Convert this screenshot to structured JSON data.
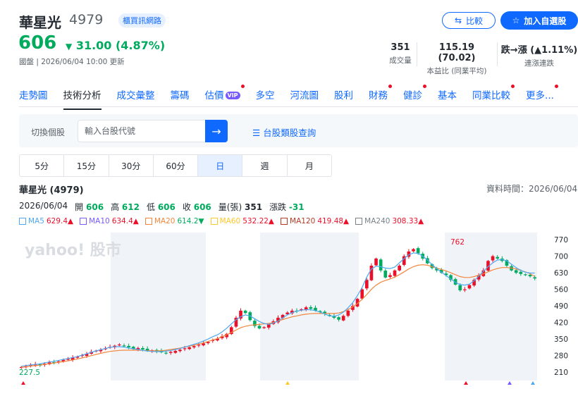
{
  "stock": {
    "name": "華星光",
    "code": "4979",
    "market_badge": "櫃買訊網路",
    "price": "606",
    "change": "31.00 (4.87%)",
    "updated": "國盤 | 2026/06/04 10:00 更新"
  },
  "actions": {
    "compare": "比較",
    "watchlist": "加入自選股"
  },
  "stats": [
    {
      "value": "351",
      "label": "成交量"
    },
    {
      "value": "115.19 (70.02)",
      "label": "本益比 (同業平均)"
    },
    {
      "value": "跌→漲 (▲1.11%)",
      "label": "連漲連跌"
    }
  ],
  "nav": [
    {
      "label": "走勢圖",
      "active": false,
      "dot": false
    },
    {
      "label": "技術分析",
      "active": true,
      "dot": false
    },
    {
      "label": "成交彙整",
      "active": false,
      "dot": false
    },
    {
      "label": "籌碼",
      "active": false,
      "dot": false
    },
    {
      "label": "估價",
      "active": false,
      "dot": true,
      "vip": "VIP"
    },
    {
      "label": "多空",
      "active": false,
      "dot": false
    },
    {
      "label": "河流圖",
      "active": false,
      "dot": false
    },
    {
      "label": "股利",
      "active": false,
      "dot": false
    },
    {
      "label": "財務",
      "active": false,
      "dot": true
    },
    {
      "label": "健診",
      "active": false,
      "dot": true
    },
    {
      "label": "基本",
      "active": false,
      "dot": false
    },
    {
      "label": "同業比較",
      "active": false,
      "dot": true
    },
    {
      "label": "更多...",
      "active": false,
      "dot": true
    }
  ],
  "search": {
    "label": "切換個股",
    "placeholder": "輸入台股代號",
    "category_link": "台股類股查詢"
  },
  "periods": [
    "5分",
    "15分",
    "30分",
    "60分",
    "日",
    "週",
    "月"
  ],
  "active_period": "日",
  "chart_header": {
    "title": "華星光 (4979)",
    "data_time": "資料時間：2026/06/04",
    "date": "2026/06/04",
    "open_label": "開",
    "open": "606",
    "high_label": "高",
    "high": "612",
    "low_label": "低",
    "low": "606",
    "close_label": "收",
    "close": "606",
    "volume_label": "量(張)",
    "volume": "351",
    "change_label": "漲跌",
    "change": "-31"
  },
  "moving_averages": [
    {
      "name": "MA5",
      "value": "629.4▲",
      "color": "#4fa8f0"
    },
    {
      "name": "MA10",
      "value": "634.4▲",
      "color": "#7759ff"
    },
    {
      "name": "MA20",
      "value": "614.2▼",
      "color": "#f2873d"
    },
    {
      "name": "MA60",
      "value": "532.22▲",
      "color": "#ffc72c"
    },
    {
      "name": "MA120",
      "value": "419.48▲",
      "color": "#b43c27"
    },
    {
      "name": "MA240",
      "value": "308.33▲",
      "color": "#7a8288"
    }
  ],
  "colors": {
    "up": "#eb0f29",
    "down": "#00ab5e",
    "accent": "#0f69ff"
  },
  "chart_data": {
    "type": "candlestick",
    "watermark": "yahoo! 股市",
    "y_ticks": [
      770,
      700,
      630,
      560,
      490,
      420,
      350,
      280,
      210
    ],
    "ylim": [
      175,
      800
    ],
    "max_label": "762",
    "min_label": "227.5",
    "closes": [
      232,
      236,
      240,
      244,
      238,
      246,
      252,
      249,
      256,
      262,
      266,
      272,
      276,
      282,
      288,
      296,
      301,
      306,
      311,
      317,
      322,
      327,
      322,
      315,
      308,
      312,
      306,
      300,
      303,
      298,
      294,
      290,
      296,
      300,
      305,
      311,
      315,
      320,
      326,
      332,
      338,
      346,
      352,
      362,
      372,
      400,
      440,
      470,
      460,
      430,
      405,
      395,
      400,
      412,
      425,
      440,
      452,
      462,
      470,
      468,
      476,
      484,
      478,
      470,
      464,
      456,
      448,
      440,
      432,
      448,
      470,
      490,
      520,
      560,
      600,
      660,
      690,
      640,
      610,
      620,
      640,
      660,
      700,
      720,
      730,
      712,
      690,
      670,
      650,
      640,
      630,
      620,
      600,
      580,
      556,
      560,
      578,
      600,
      620,
      640,
      680,
      700,
      690,
      680,
      660,
      640,
      630,
      625,
      620,
      615,
      606
    ],
    "ma5": [
      235,
      238,
      241,
      243,
      245,
      250,
      253,
      256,
      260,
      264,
      268,
      272,
      276,
      282,
      288,
      294,
      300,
      305,
      310,
      315,
      318,
      318,
      316,
      312,
      309,
      306,
      302,
      299,
      298,
      297,
      297,
      299,
      302,
      306,
      310,
      316,
      322,
      328,
      334,
      342,
      350,
      360,
      368,
      380,
      396,
      414,
      432,
      444,
      452,
      448,
      436,
      424,
      416,
      412,
      418,
      426,
      440,
      452,
      462,
      468,
      472,
      474,
      474,
      470,
      464,
      456,
      448,
      446,
      452,
      464,
      482,
      504,
      534,
      568,
      612,
      646,
      658,
      656,
      650,
      648,
      654,
      672,
      690,
      706,
      714,
      712,
      700,
      684,
      664,
      648,
      632,
      618,
      604,
      590,
      580,
      578,
      582,
      596,
      616,
      636,
      656,
      672,
      684,
      686,
      680,
      666,
      652,
      640,
      632,
      629,
      629
    ],
    "ma20": [
      230,
      233,
      236,
      238,
      240,
      243,
      246,
      249,
      252,
      255,
      258,
      262,
      266,
      270,
      275,
      280,
      285,
      290,
      294,
      298,
      300,
      302,
      303,
      303,
      303,
      303,
      302,
      301,
      301,
      300,
      301,
      303,
      306,
      309,
      312,
      316,
      320,
      324,
      328,
      334,
      340,
      346,
      352,
      360,
      368,
      378,
      388,
      398,
      404,
      408,
      410,
      412,
      414,
      416,
      420,
      426,
      432,
      438,
      444,
      448,
      452,
      455,
      457,
      458,
      458,
      458,
      458,
      458,
      460,
      466,
      474,
      486,
      500,
      518,
      538,
      560,
      578,
      590,
      598,
      604,
      612,
      622,
      634,
      646,
      656,
      662,
      664,
      662,
      656,
      650,
      644,
      638,
      630,
      622,
      614,
      610,
      610,
      614,
      620,
      626,
      634,
      642,
      648,
      652,
      652,
      650,
      646,
      640,
      634,
      626,
      614
    ]
  }
}
